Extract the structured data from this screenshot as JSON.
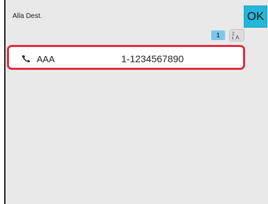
{
  "header": {
    "title": "Alla Dest.",
    "ok_label": "OK"
  },
  "pagination": {
    "current_page": "1"
  },
  "sort": {
    "icon": "sort-az-icon"
  },
  "list": {
    "items": [
      {
        "icon": "phone-icon",
        "name": "AAA",
        "number": "1-1234567890",
        "selected": true
      }
    ]
  },
  "colors": {
    "accent": "#24b8d8",
    "selected_border": "#e02c40",
    "page_indicator": "#7fc7e9",
    "panel_bg": "#e9e9e9"
  }
}
